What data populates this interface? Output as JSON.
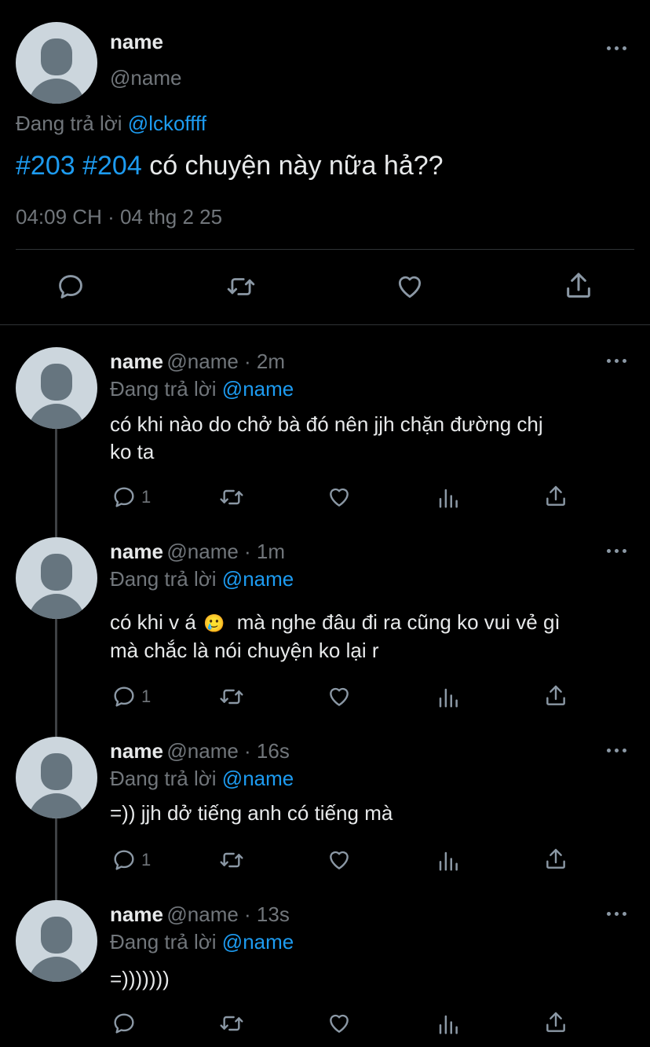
{
  "main_tweet": {
    "name": "name",
    "handle": "@name",
    "reply_prefix": "Đang trả lời",
    "reply_to": "@lckoffff",
    "hashtag1": "#203",
    "hashtag2": "#204",
    "text": "có chuyện này nữa hả??",
    "timestamp": "04:09 CH · 04 thg 2 25"
  },
  "replies": [
    {
      "name": "name",
      "handle_time": "@name · 2m",
      "reply_prefix": "Đang trả lời",
      "reply_to": "@name",
      "line1": "có khi nào do chở bà đó nên jjh chặn đường chj",
      "line2": "ko ta",
      "reply_count": "1"
    },
    {
      "name": "name",
      "handle_time": "@name · 1m",
      "reply_prefix": "Đang trả lời",
      "reply_to": "@name",
      "line1_a": "có khi v á",
      "emoji": "🥲",
      "line1_b": "mà nghe đâu đi ra cũng ko vui vẻ gì",
      "line2": "mà chắc là nói chuyện ko lại r",
      "reply_count": "1"
    },
    {
      "name": "name",
      "handle_time": "@name · 16s",
      "reply_prefix": "Đang trả lời",
      "reply_to": "@name",
      "line1": "=)) jjh dở tiếng anh có tiếng mà",
      "reply_count": "1"
    },
    {
      "name": "name",
      "handle_time": "@name · 13s",
      "reply_prefix": "Đang trả lời",
      "reply_to": "@name",
      "line1": "=)))))))",
      "reply_count": ""
    }
  ],
  "icons": {
    "more": "more-horizontal-icon",
    "reply": "reply-bubble-icon",
    "retweet": "retweet-icon",
    "like": "heart-icon",
    "views": "views-bar-chart-icon",
    "share": "share-upload-icon",
    "avatar": "default-avatar-icon"
  },
  "colors": {
    "background": "#000000",
    "text": "#e7e9ea",
    "muted": "#71767b",
    "link": "#1d9bf0",
    "icon": "#8b98a5",
    "divider": "#2f3336"
  }
}
